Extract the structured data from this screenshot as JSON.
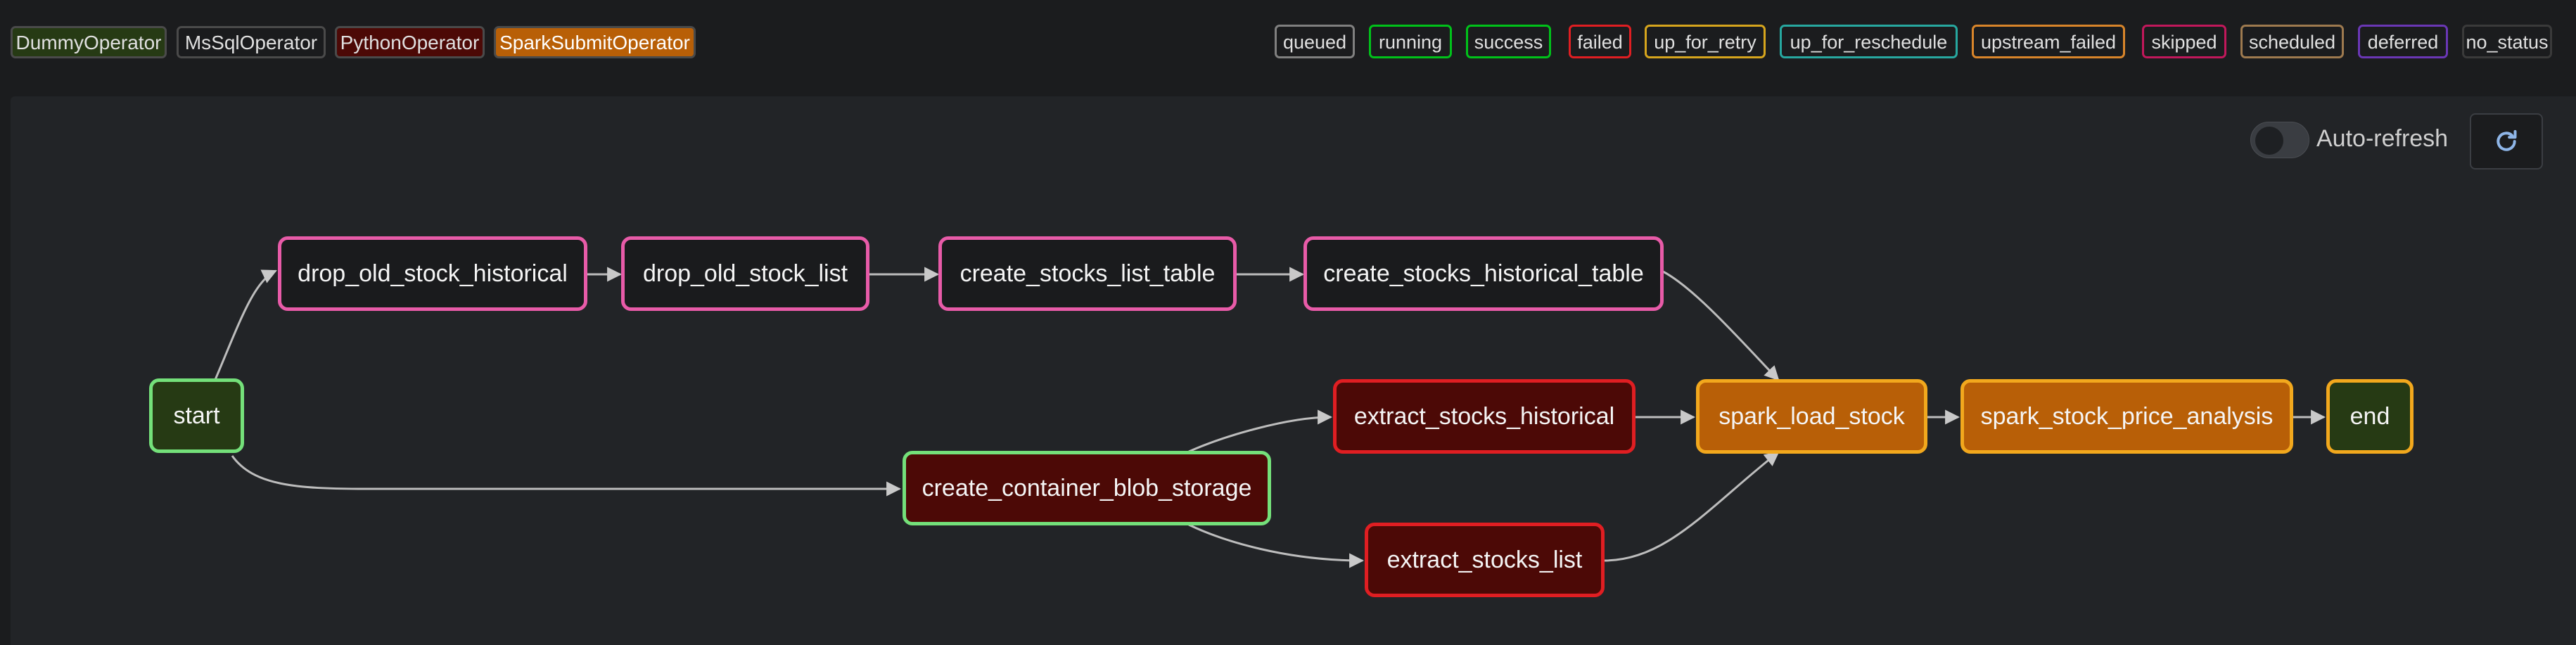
{
  "operators": [
    {
      "label": "DummyOperator",
      "bg": "#263a14",
      "border": "#4a4a4a"
    },
    {
      "label": "MsSqlOperator",
      "bg": "#1a1b1d",
      "border": "#4a4a4a"
    },
    {
      "label": "PythonOperator",
      "bg": "#4c0906",
      "border": "#4a4a4a"
    },
    {
      "label": "SparkSubmitOperator",
      "bg": "#b85f07",
      "border": "#4a4a4a"
    }
  ],
  "states": [
    {
      "label": "queued",
      "color": "#808080"
    },
    {
      "label": "running",
      "color": "#00c21a"
    },
    {
      "label": "success",
      "color": "#00c21a"
    },
    {
      "label": "failed",
      "color": "#e01e22"
    },
    {
      "label": "up_for_retry",
      "color": "#d6a51d"
    },
    {
      "label": "up_for_reschedule",
      "color": "#27a8a0"
    },
    {
      "label": "upstream_failed",
      "color": "#d9852a"
    },
    {
      "label": "skipped",
      "color": "#c2185b"
    },
    {
      "label": "scheduled",
      "color": "#9e7a4f"
    },
    {
      "label": "deferred",
      "color": "#6a37b5"
    },
    {
      "label": "no_status",
      "color": "#3a3a3a"
    }
  ],
  "controls": {
    "auto_refresh_label": "Auto-refresh",
    "refresh_icon": "refresh-icon"
  },
  "graph": {
    "nodes": {
      "start": "start",
      "drop_old_stock_historical": "drop_old_stock_historical",
      "drop_old_stock_list": "drop_old_stock_list",
      "create_stocks_list_table": "create_stocks_list_table",
      "create_stocks_historical_table": "create_stocks_historical_table",
      "create_container_blob_storage": "create_container_blob_storage",
      "extract_stocks_historical": "extract_stocks_historical",
      "extract_stocks_list": "extract_stocks_list",
      "spark_load_stock": "spark_load_stock",
      "spark_stock_price_analysis": "spark_stock_price_analysis",
      "end": "end"
    },
    "edges": [
      [
        "start",
        "drop_old_stock_historical"
      ],
      [
        "drop_old_stock_historical",
        "drop_old_stock_list"
      ],
      [
        "drop_old_stock_list",
        "create_stocks_list_table"
      ],
      [
        "create_stocks_list_table",
        "create_stocks_historical_table"
      ],
      [
        "create_stocks_historical_table",
        "spark_load_stock"
      ],
      [
        "start",
        "create_container_blob_storage"
      ],
      [
        "create_container_blob_storage",
        "extract_stocks_historical"
      ],
      [
        "create_container_blob_storage",
        "extract_stocks_list"
      ],
      [
        "extract_stocks_historical",
        "spark_load_stock"
      ],
      [
        "extract_stocks_list",
        "spark_load_stock"
      ],
      [
        "spark_load_stock",
        "spark_stock_price_analysis"
      ],
      [
        "spark_stock_price_analysis",
        "end"
      ]
    ]
  }
}
